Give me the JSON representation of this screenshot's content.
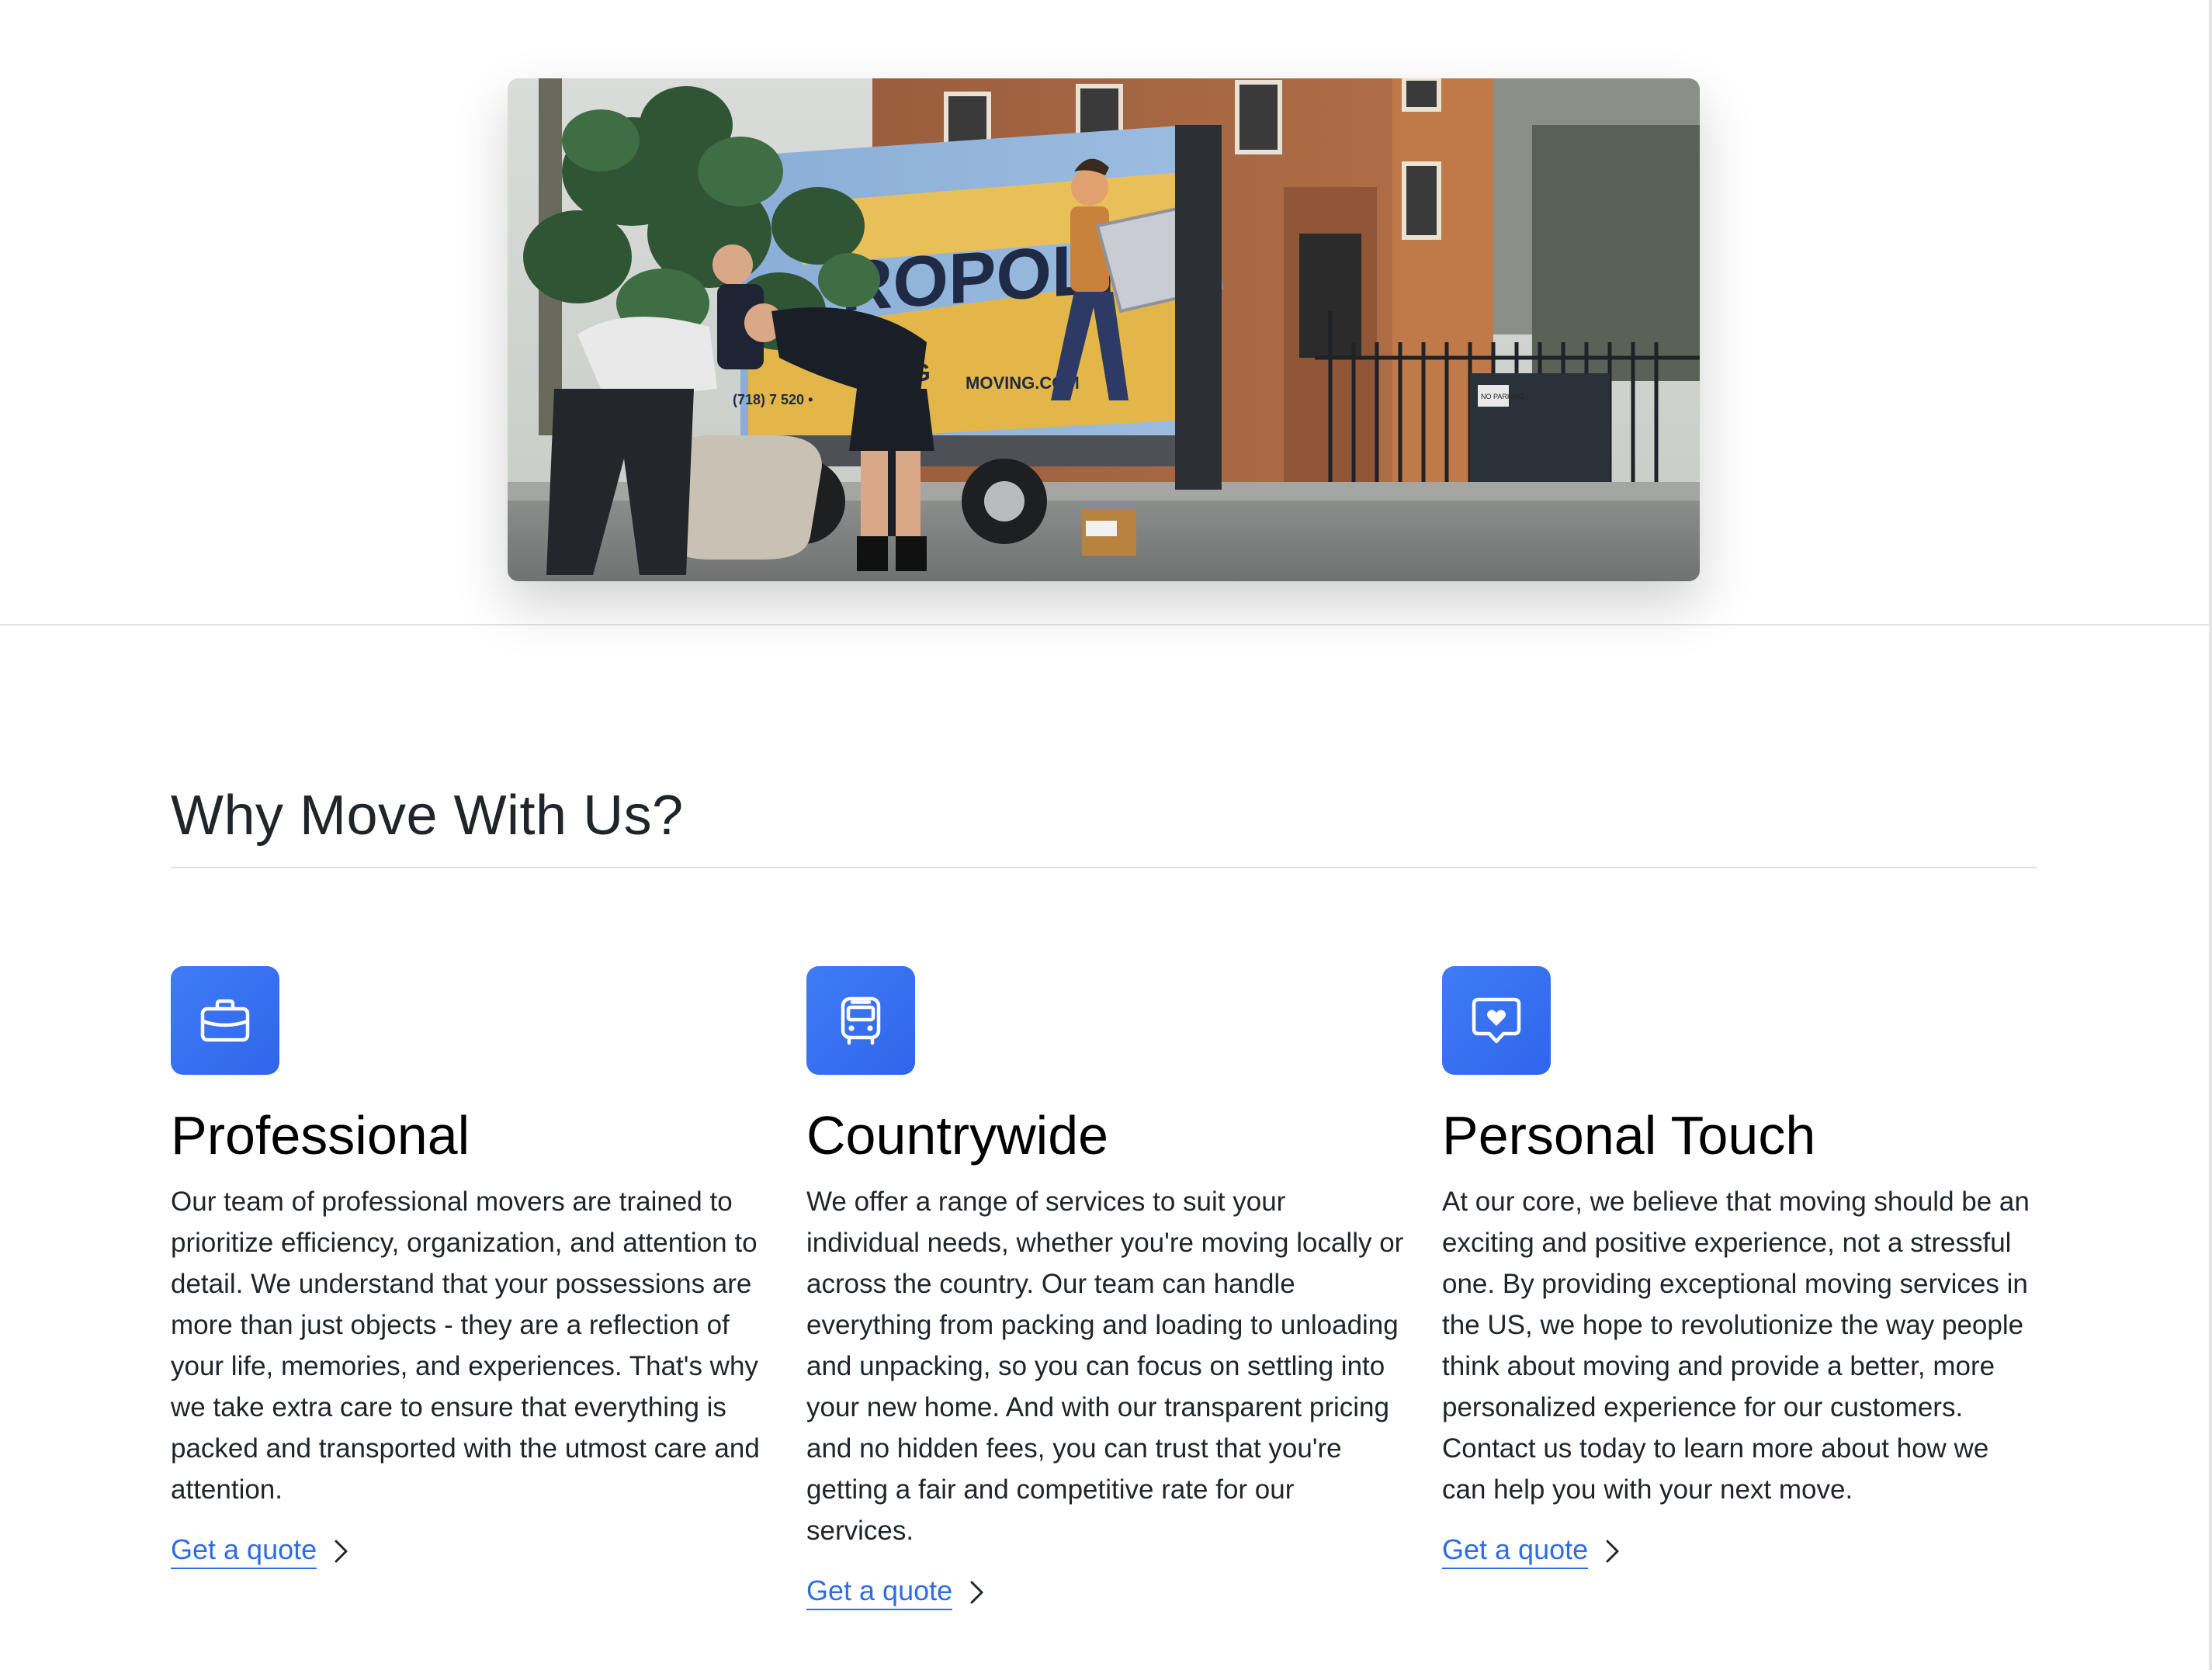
{
  "hero": {
    "image_name": "moving-crew-truck-photo",
    "truck_text": {
      "brand": "ROPOLIS",
      "sub": "G",
      "website": "MOVING.COM",
      "phone": "(718) 7   520 •"
    },
    "sign_text": "NO PARKING"
  },
  "features_section": {
    "title": "Why Move With Us?",
    "items": [
      {
        "icon": "briefcase-icon",
        "title": "Professional",
        "text": "Our team of professional movers are trained to prioritize efficiency, organization, and attention to detail. We understand that your possessions are more than just objects - they are a reflection of your life, memories, and experiences. That's why we take extra care to ensure that everything is packed and transported with the utmost care and attention.",
        "link_label": "Get a quote"
      },
      {
        "icon": "bus-icon",
        "title": "Countrywide",
        "text": "We offer a range of services to suit your individual needs, whether you're moving locally or across the country. Our team can handle everything from packing and loading to unloading and unpacking, so you can focus on settling into your new home. And with our transparent pricing and no hidden fees, you can trust that you're getting a fair and competitive rate for our services.",
        "link_label": "Get a quote"
      },
      {
        "icon": "chat-heart-icon",
        "title": "Personal Touch",
        "text": "At our core, we believe that moving should be an exciting and positive experience, not a stressful one. By providing exceptional moving services in the US, we hope to revolutionize the way people think about moving and provide a better, more personalized experience for our customers. Contact us today to learn more about how we can help you with your next move.",
        "link_label": "Get a quote"
      }
    ]
  },
  "colors": {
    "accent": "#2f6ce3",
    "icon_bg": "#3370ef",
    "text": "#212529"
  }
}
